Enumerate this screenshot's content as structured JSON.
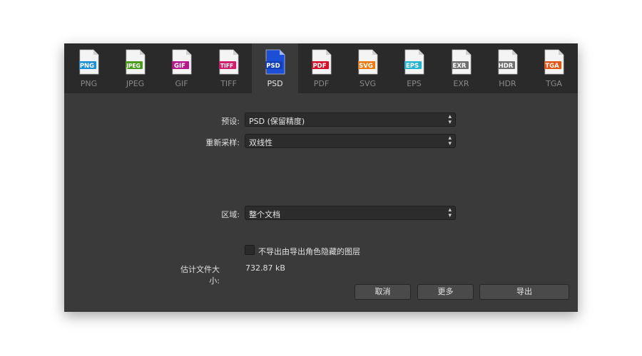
{
  "formats": [
    {
      "badge": "PNG",
      "label": "PNG",
      "color": "#1a8fd6",
      "icon": "png-file-icon",
      "active": false
    },
    {
      "badge": "JPEG",
      "label": "JPEG",
      "color": "#4b9b1d",
      "icon": "jpeg-file-icon",
      "active": false
    },
    {
      "badge": "GIF",
      "label": "GIF",
      "color": "#b8168e",
      "icon": "gif-file-icon",
      "active": false
    },
    {
      "badge": "TIFF",
      "label": "TIFF",
      "color": "#d21d6d",
      "icon": "tiff-file-icon",
      "active": false
    },
    {
      "badge": "PSD",
      "label": "PSD",
      "color": "#1d4fd6",
      "icon": "psd-file-icon",
      "active": true
    },
    {
      "badge": "PDF",
      "label": "PDF",
      "color": "#d3122a",
      "icon": "pdf-file-icon",
      "active": false
    },
    {
      "badge": "SVG",
      "label": "SVG",
      "color": "#ec7a12",
      "icon": "svg-file-icon",
      "active": false
    },
    {
      "badge": "EPS",
      "label": "EPS",
      "color": "#25b3d2",
      "icon": "eps-file-icon",
      "active": false
    },
    {
      "badge": "EXR",
      "label": "EXR",
      "color": "#6f6f6f",
      "icon": "exr-file-icon",
      "active": false
    },
    {
      "badge": "HDR",
      "label": "HDR",
      "color": "#6f6f6f",
      "icon": "hdr-file-icon",
      "active": false
    },
    {
      "badge": "TGA",
      "label": "TGA",
      "color": "#e25417",
      "icon": "tga-file-icon",
      "active": false
    }
  ],
  "settings": {
    "preset_label": "预设:",
    "preset_value": "PSD (保留精度)",
    "resample_label": "重新采样:",
    "resample_value": "双线性",
    "area_label": "区域:",
    "area_value": "整个文档"
  },
  "options": {
    "hide_layers_label": "不导出由导出角色隐藏的图层",
    "hide_layers_checked": false
  },
  "estimate": {
    "label": "估计文件大小:",
    "value": "732.87 kB"
  },
  "buttons": {
    "cancel": "取消",
    "more": "更多",
    "export": "导出"
  }
}
